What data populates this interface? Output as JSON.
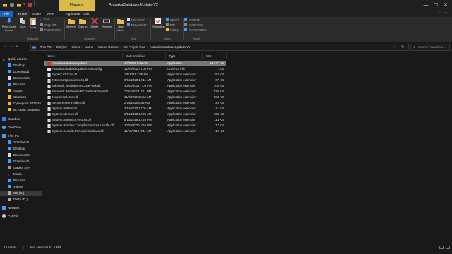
{
  "titlebar": {
    "context_tab": "Manage",
    "title": "ArasakaDatabaseUpdaterV2",
    "minimize": "—",
    "maximize": "☐",
    "close": "✕"
  },
  "tabs": {
    "file": "File",
    "home": "Home",
    "share": "Share",
    "view": "View",
    "app_tools": "Application Tools"
  },
  "ribbon": {
    "pin": "Pin to Quick access",
    "copy": "Copy",
    "paste": "Paste",
    "cut": "Cut",
    "copy_path": "Copy path",
    "paste_shortcut": "Paste shortcut",
    "move_to": "Move to",
    "copy_to": "Copy to",
    "delete": "Delete",
    "rename": "Rename",
    "new_folder": "New folder",
    "new_item": "New item",
    "easy_access": "Easy access",
    "properties": "Properties",
    "open": "Open",
    "edit": "Edit",
    "history": "History",
    "select_all": "Select all",
    "select_none": "Select none",
    "invert_selection": "Invert selection",
    "groups": {
      "clipboard": "Clipboard",
      "organize": "Organize",
      "new": "New",
      "open": "Open",
      "select": "Select"
    }
  },
  "address": {
    "crumbs": [
      "This PC",
      "OS (C:)",
      "Users",
      "kdone",
      "Saved Games",
      "CD Projekt Red",
      "ArasakaDatabaseUpdaterV2"
    ],
    "search_placeholder": "Search ArasakaD..."
  },
  "nav": {
    "quick_access": "Quick access",
    "desktop": "Desktop",
    "downloads": "Downloads",
    "documents": "Documents",
    "pictures": "Pictures",
    "austin": "Austin",
    "captures": "Captures",
    "cyberpunk": "Cyberpunk 2077 sv",
    "history_ukraine": "Истории Украины",
    "dropbox": "Dropbox",
    "onedrive": "OneDrive",
    "this_pc": "This PC",
    "objects3d": "3D Objects",
    "desktop2": "Desktop",
    "documents2": "Documents",
    "downloads2": "Downloads",
    "galaxy": "Galaxy S9+",
    "music": "Music",
    "pictures2": "Pictures",
    "videos": "Videos",
    "os_c": "OS (C:)",
    "data_d": "DATA (D:)",
    "network": "Network",
    "catchit": "Catchit"
  },
  "columns": {
    "name": "Name",
    "date": "Date modified",
    "type": "Type",
    "size": "Size"
  },
  "files": [
    {
      "name": "ArasakaDatabaseUpdater",
      "date": "1/7/2021 3:51 AM",
      "type": "Application",
      "size": "52,777 KB",
      "icon": "app-red",
      "selected": true
    },
    {
      "name": "ArasakaDatabaseUpdater.exe.config",
      "date": "12/29/2020 6:00 PM",
      "type": "CONFIG File",
      "size": "1 KB",
      "icon": "config"
    },
    {
      "name": "CyberCAT.Core.dll",
      "date": "1/5/2021 1:55 AM",
      "type": "Application extension",
      "size": "57 KB",
      "icon": "dll"
    },
    {
      "name": "K4os.Compression.LZ4.dll",
      "date": "9/12/2020 12:11 AM",
      "type": "Application extension",
      "size": "67 KB",
      "icon": "dll"
    },
    {
      "name": "Microsoft.WindowsAPICodePack.dll",
      "date": "10/24/2014 7:09 PM",
      "type": "Application extension",
      "size": "105 KB",
      "icon": "dll"
    },
    {
      "name": "Microsoft.WindowsAPICodePack.Shell.dll",
      "date": "10/24/2014 7:11 PM",
      "type": "Application extension",
      "size": "530 KB",
      "icon": "dll"
    },
    {
      "name": "Newtonsoft.Json.dll",
      "date": "11/9/2019 12:56 AM",
      "type": "Application extension",
      "size": "684 KB",
      "icon": "dll"
    },
    {
      "name": "Syroot.KnownFolders.dll",
      "date": "2/26/2020 8:32 AM",
      "type": "Application extension",
      "size": "20 KB",
      "icon": "dll"
    },
    {
      "name": "System.Buffers.dll",
      "date": "2/19/2020 10:05 AM",
      "type": "Application extension",
      "size": "21 KB",
      "icon": "dll"
    },
    {
      "name": "System.Memory.dll",
      "date": "2/19/2020 10:05 AM",
      "type": "Application extension",
      "size": "138 KB",
      "icon": "dll"
    },
    {
      "name": "System.Numerics.Vectors.dll",
      "date": "5/15/2018 12:29 PM",
      "type": "Application extension",
      "size": "114 KB",
      "icon": "dll"
    },
    {
      "name": "System.Runtime.CompilerServices.Unsafe.dll",
      "date": "10/19/2020 5:46 PM",
      "type": "Application extension",
      "size": "17 KB",
      "icon": "dll"
    },
    {
      "name": "System.Security.Principal.Windows.dll",
      "date": "11/15/2019 8:41 AM",
      "type": "Application extension",
      "size": "18 KB",
      "icon": "dll"
    }
  ],
  "status": {
    "items": "13 items",
    "selected": "1 item selected  51.5 MB"
  },
  "colors": {
    "accent": "#1a63c4",
    "manage_tab": "#d9bb4a",
    "selection": "#777777",
    "background": "#191919"
  }
}
